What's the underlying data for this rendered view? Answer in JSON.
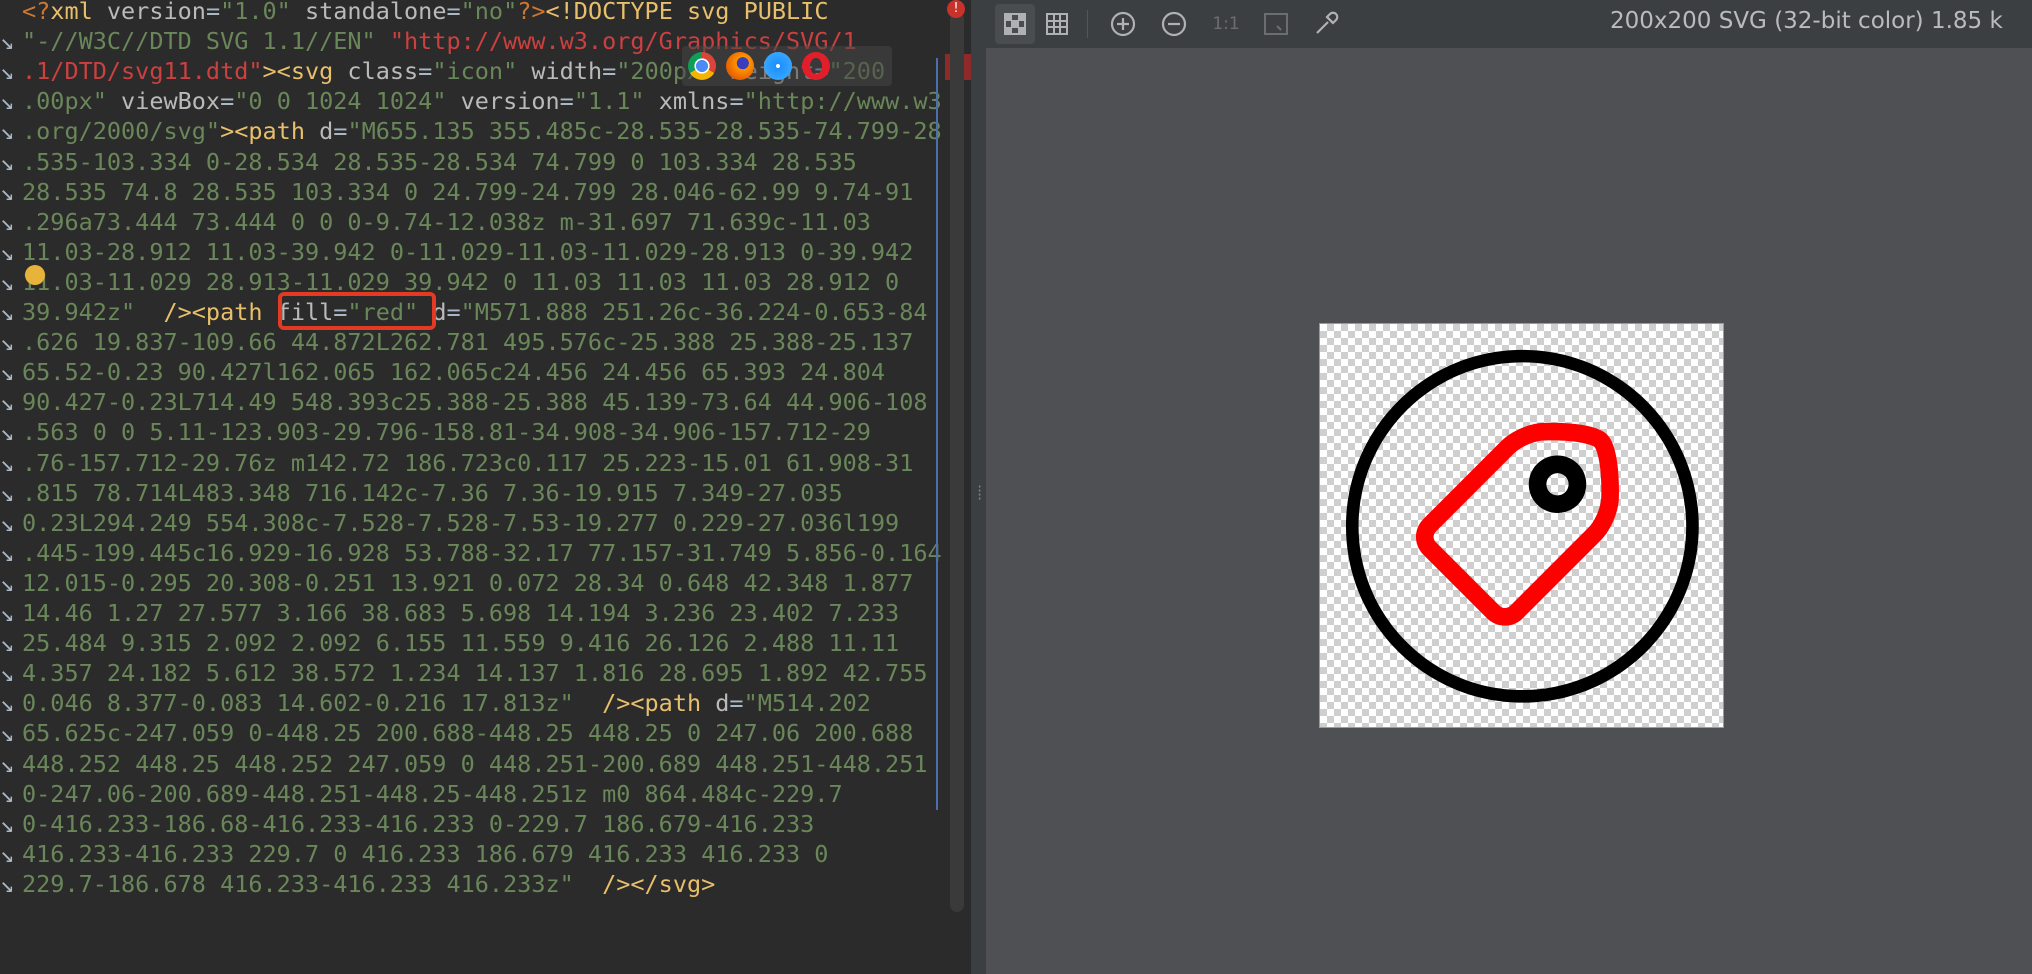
{
  "editor": {
    "lines": [
      {
        "segments": [
          [
            "tk-kw",
            "<?"
          ],
          [
            "tk-tag",
            "xml "
          ],
          [
            "tk-attr",
            "version"
          ],
          [
            "tk-plain",
            "="
          ],
          [
            "tk-str",
            "\"1.0\" "
          ],
          [
            "tk-attr",
            "standalone"
          ],
          [
            "tk-plain",
            "="
          ],
          [
            "tk-str",
            "\"no\""
          ],
          [
            "tk-kw",
            "?>"
          ],
          [
            "tk-tag",
            "<!DOCTYPE svg PUBLIC"
          ]
        ]
      },
      {
        "segments": [
          [
            "tk-str",
            "\"-//W3C//DTD SVG 1.1//EN\" "
          ],
          [
            "tk-url",
            "\"http://www.w3.org/Graphics/SVG/1"
          ]
        ]
      },
      {
        "segments": [
          [
            "tk-url",
            ".1/DTD/svg11.dtd\""
          ],
          [
            "tk-tag",
            "><svg "
          ],
          [
            "tk-attr",
            "class"
          ],
          [
            "tk-plain",
            "="
          ],
          [
            "tk-str",
            "\"icon\" "
          ],
          [
            "tk-attr",
            "width"
          ],
          [
            "tk-plain",
            "="
          ],
          [
            "tk-str",
            "\"200px\" "
          ],
          [
            "tk-attr",
            "height"
          ],
          [
            "tk-plain",
            "="
          ],
          [
            "tk-str",
            "\"200"
          ]
        ]
      },
      {
        "segments": [
          [
            "tk-str",
            ".00px\" "
          ],
          [
            "tk-attr",
            "viewBox"
          ],
          [
            "tk-plain",
            "="
          ],
          [
            "tk-str",
            "\"0 0 1024 1024\" "
          ],
          [
            "tk-attr",
            "version"
          ],
          [
            "tk-plain",
            "="
          ],
          [
            "tk-str",
            "\"1.1\" "
          ],
          [
            "tk-attr",
            "xmlns"
          ],
          [
            "tk-plain",
            "="
          ],
          [
            "tk-str",
            "\"http://www.w3"
          ]
        ]
      },
      {
        "segments": [
          [
            "tk-str",
            ".org/2000/svg\""
          ],
          [
            "tk-tag",
            "><path "
          ],
          [
            "tk-attr",
            "d"
          ],
          [
            "tk-plain",
            "="
          ],
          [
            "tk-str",
            "\"M655.135 355.485c-28.535-28.535-74.799-28"
          ]
        ]
      },
      {
        "segments": [
          [
            "tk-str",
            ".535-103.334 0-28.534 28.535-28.534 74.799 0 103.334 28.535"
          ]
        ]
      },
      {
        "segments": [
          [
            "tk-str",
            "28.535 74.8 28.535 103.334 0 24.799-24.799 28.046-62.99 9.74-91"
          ]
        ]
      },
      {
        "segments": [
          [
            "tk-str",
            ".296a73.444 73.444 0 0 0-9.74-12.038z m-31.697 71.639c-11.03"
          ]
        ]
      },
      {
        "segments": [
          [
            "tk-str",
            "11.03-28.912 11.03-39.942 0-11.029-11.03-11.029-28.913 0-39.942"
          ]
        ]
      },
      {
        "segments": [
          [
            "tk-str",
            "11.03-11.029 28.913-11.029 39.942 0 11.03 11.03 11.03 28.912 0"
          ]
        ]
      },
      {
        "segments": [
          [
            "tk-str",
            "39.942z\"  "
          ],
          [
            "tk-tag",
            "/><path "
          ],
          [
            "tk-attr",
            "fill"
          ],
          [
            "tk-plain",
            "="
          ],
          [
            "tk-str",
            "\"red\" "
          ],
          [
            "tk-attr",
            "d"
          ],
          [
            "tk-plain",
            "="
          ],
          [
            "tk-str",
            "\"M571.888 251.26c-36.224-0.653-84"
          ]
        ]
      },
      {
        "segments": [
          [
            "tk-str",
            ".626 19.837-109.66 44.872L262.781 495.576c-25.388 25.388-25.137"
          ]
        ]
      },
      {
        "segments": [
          [
            "tk-str",
            "65.52-0.23 90.427l162.065 162.065c24.456 24.456 65.393 24.804"
          ]
        ]
      },
      {
        "segments": [
          [
            "tk-str",
            "90.427-0.23L714.49 548.393c25.388-25.388 45.139-73.64 44.906-108"
          ]
        ]
      },
      {
        "segments": [
          [
            "tk-str",
            ".563 0 0 5.11-123.903-29.796-158.81-34.908-34.906-157.712-29"
          ]
        ]
      },
      {
        "segments": [
          [
            "tk-str",
            ".76-157.712-29.76z m142.72 186.723c0.117 25.223-15.01 61.908-31"
          ]
        ]
      },
      {
        "segments": [
          [
            "tk-str",
            ".815 78.714L483.348 716.142c-7.36 7.36-19.915 7.349-27.035"
          ]
        ]
      },
      {
        "segments": [
          [
            "tk-str",
            "0.23L294.249 554.308c-7.528-7.528-7.53-19.277 0.229-27.036l199"
          ]
        ]
      },
      {
        "segments": [
          [
            "tk-str",
            ".445-199.445c16.929-16.928 53.788-32.17 77.157-31.749 5.856-0.164"
          ]
        ]
      },
      {
        "segments": [
          [
            "tk-str",
            "12.015-0.295 20.308-0.251 13.921 0.072 28.34 0.648 42.348 1.877"
          ]
        ]
      },
      {
        "segments": [
          [
            "tk-str",
            "14.46 1.27 27.577 3.166 38.683 5.698 14.194 3.236 23.402 7.233"
          ]
        ]
      },
      {
        "segments": [
          [
            "tk-str",
            "25.484 9.315 2.092 2.092 6.155 11.559 9.416 26.126 2.488 11.11"
          ]
        ]
      },
      {
        "segments": [
          [
            "tk-str",
            "4.357 24.182 5.612 38.572 1.234 14.137 1.816 28.695 1.892 42.755"
          ]
        ]
      },
      {
        "segments": [
          [
            "tk-str",
            "0.046 8.377-0.083 14.602-0.216 17.813z\"  "
          ],
          [
            "tk-tag",
            "/><path "
          ],
          [
            "tk-attr",
            "d"
          ],
          [
            "tk-plain",
            "="
          ],
          [
            "tk-str",
            "\"M514.202"
          ]
        ]
      },
      {
        "segments": [
          [
            "tk-str",
            "65.625c-247.059 0-448.25 200.688-448.25 448.25 0 247.06 200.688"
          ]
        ]
      },
      {
        "segments": [
          [
            "tk-str",
            "448.252 448.25 448.252 247.059 0 448.251-200.689 448.251-448.251"
          ]
        ]
      },
      {
        "segments": [
          [
            "tk-str",
            "0-247.06-200.689-448.251-448.25-448.251z m0 864.484c-229.7"
          ]
        ]
      },
      {
        "segments": [
          [
            "tk-str",
            "0-416.233-186.68-416.233-416.233 0-229.7 186.679-416.233"
          ]
        ]
      },
      {
        "segments": [
          [
            "tk-str",
            "416.233-416.233 229.7 0 416.233 186.679 416.233 416.233 0"
          ]
        ]
      },
      {
        "segments": [
          [
            "tk-str",
            "229.7-186.678 416.233-416.233 416.233z\"  "
          ],
          [
            "tk-tag",
            "/></svg>"
          ]
        ]
      }
    ]
  },
  "toolbar": {
    "zoom_one_label": "1:1",
    "image_info": "200x200 SVG (32-bit color) 1.85 k"
  },
  "icons": {
    "transparency": "checkerboard-icon",
    "grid": "grid-icon",
    "zoom_in": "zoom-in-icon",
    "zoom_out": "zoom-out-icon",
    "fit": "fit-window-icon",
    "picker": "color-picker-icon"
  },
  "preview": {
    "circle_color": "#000000",
    "tag_color": "#ff0000",
    "hole_color": "#000000"
  }
}
